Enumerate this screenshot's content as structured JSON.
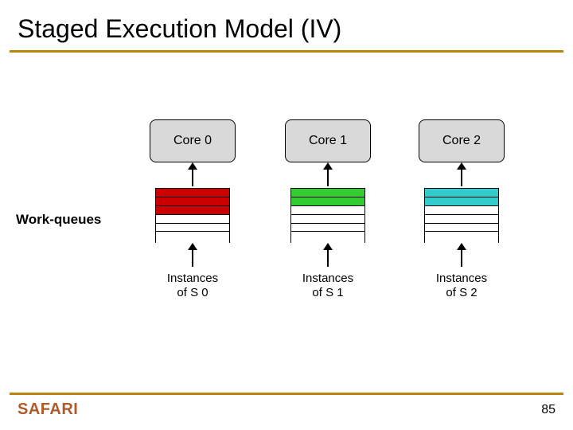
{
  "title": "Staged Execution Model (IV)",
  "cores": [
    {
      "label": "Core 0",
      "filled": 3,
      "color": "c0",
      "instances_l1": "Instances",
      "instances_l2": "of S 0"
    },
    {
      "label": "Core 1",
      "filled": 2,
      "color": "c1",
      "instances_l1": "Instances",
      "instances_l2": "of S 1"
    },
    {
      "label": "Core 2",
      "filled": 2,
      "color": "c2",
      "instances_l1": "Instances",
      "instances_l2": "of S 2"
    }
  ],
  "workqueues_label": "Work-queues",
  "logo": "SAFARI",
  "page_number": "85"
}
